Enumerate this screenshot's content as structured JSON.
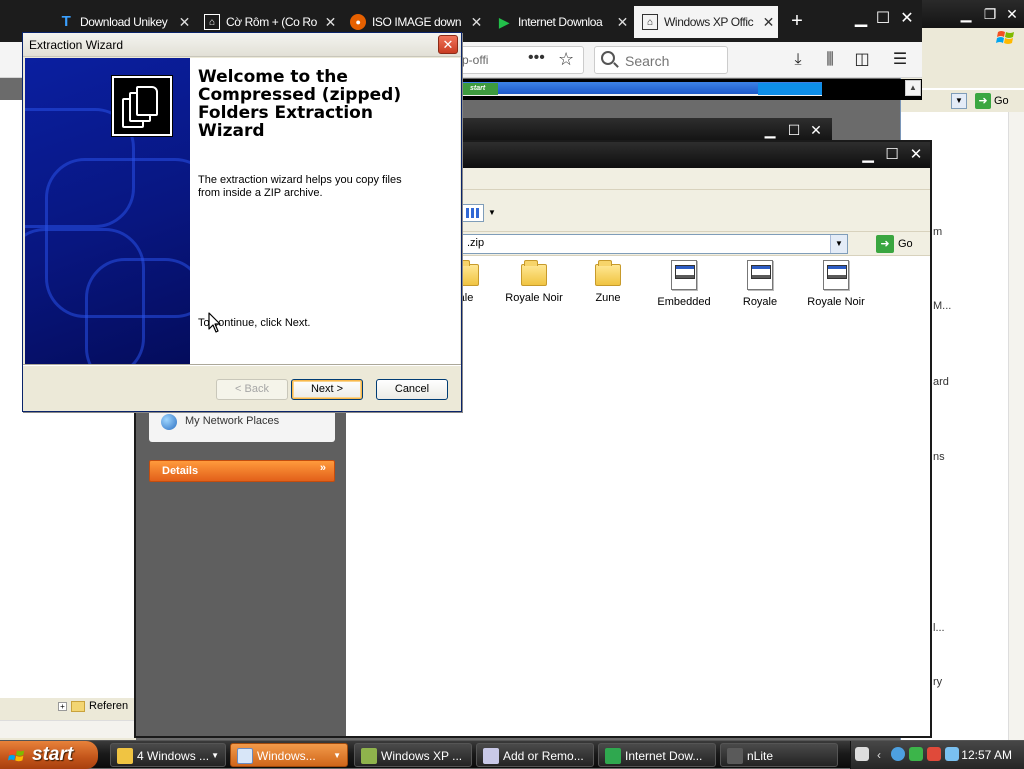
{
  "browser": {
    "tabs": [
      {
        "label": "Download Unikey",
        "icon": "T"
      },
      {
        "label": "Cờ Rôm + (Co Ro",
        "icon": "building"
      },
      {
        "label": "ISO IMAGE down",
        "icon": "fox"
      },
      {
        "label": "Internet Downloa",
        "icon": "play"
      },
      {
        "label": "Windows XP Offic",
        "icon": "building"
      }
    ],
    "url_fragment": "p-offi",
    "search_placeholder": "Search"
  },
  "bg_right": {
    "go_label": "Go",
    "fragments": [
      "m",
      "M...",
      "ard",
      "ns",
      "l...",
      "ry"
    ]
  },
  "left_explorer": {
    "tree_item": "Referen"
  },
  "explorer": {
    "address": ".zip",
    "go_label": "Go",
    "network_places": "My Network Places",
    "details_label": "Details",
    "files": [
      {
        "label": "ale",
        "kind": "folder"
      },
      {
        "label": "Royale Noir",
        "kind": "folder"
      },
      {
        "label": "Zune",
        "kind": "folder"
      },
      {
        "label": "Embedded",
        "kind": "theme"
      },
      {
        "label": "Royale",
        "kind": "theme"
      },
      {
        "label": "Royale Noir",
        "kind": "theme"
      }
    ]
  },
  "wizard": {
    "title": "Extraction Wizard",
    "heading": "Welcome to the Compressed (zipped) Folders Extraction Wizard",
    "description": "The extraction wizard helps you copy files from inside a ZIP archive.",
    "continue_text": "To continue, click Next.",
    "back_label": "< Back",
    "next_label": "Next >",
    "cancel_label": "Cancel"
  },
  "taskbar": {
    "start_label": "start",
    "tasks": [
      {
        "label": "4 Windows ...",
        "active": false
      },
      {
        "label": "Windows...",
        "active": true
      },
      {
        "label": "Windows XP ...",
        "active": false
      },
      {
        "label": "Add or Remo...",
        "active": false
      },
      {
        "label": "Internet Dow...",
        "active": false
      },
      {
        "label": "nLite",
        "active": false
      }
    ],
    "clock": "12:57 AM"
  },
  "colors": {
    "xp_orange": "#e2601a",
    "wizard_blue": "#081680",
    "titlebar_dark": "#121212"
  }
}
